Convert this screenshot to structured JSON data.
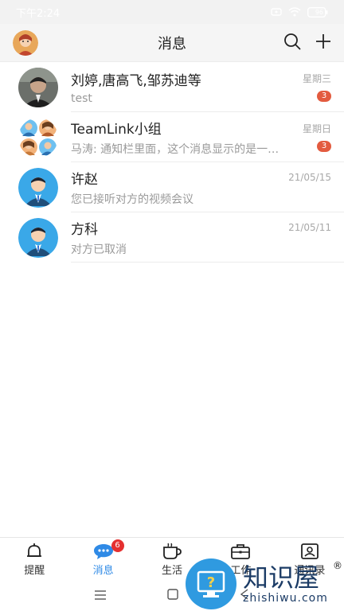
{
  "status_bar": {
    "time": "下午2:24",
    "battery": "96"
  },
  "header": {
    "title": "消息"
  },
  "messages": [
    {
      "name": "刘婷,唐高飞,邹苏迪等",
      "preview": "test",
      "time": "星期三",
      "badge": "3"
    },
    {
      "name": "TeamLink小组",
      "preview": "马涛: 通知栏里面，这个消息显示的是一…",
      "time": "星期日",
      "badge": "3"
    },
    {
      "name": "许赵",
      "preview": "您已接听对方的视频会议",
      "time": "21/05/15",
      "badge": ""
    },
    {
      "name": "方科",
      "preview": "对方已取消",
      "time": "21/05/11",
      "badge": ""
    }
  ],
  "tabs": [
    {
      "label": "提醒"
    },
    {
      "label": "消息",
      "badge": "6"
    },
    {
      "label": "生活"
    },
    {
      "label": "工作"
    },
    {
      "label": "通讯录"
    }
  ],
  "watermark": {
    "cn": "知识屋",
    "en": "zhishiwu.com",
    "reg": "®"
  },
  "colors": {
    "accent": "#2f8ae6",
    "badge": "#e35b3f",
    "tab_badge": "#e53030"
  }
}
